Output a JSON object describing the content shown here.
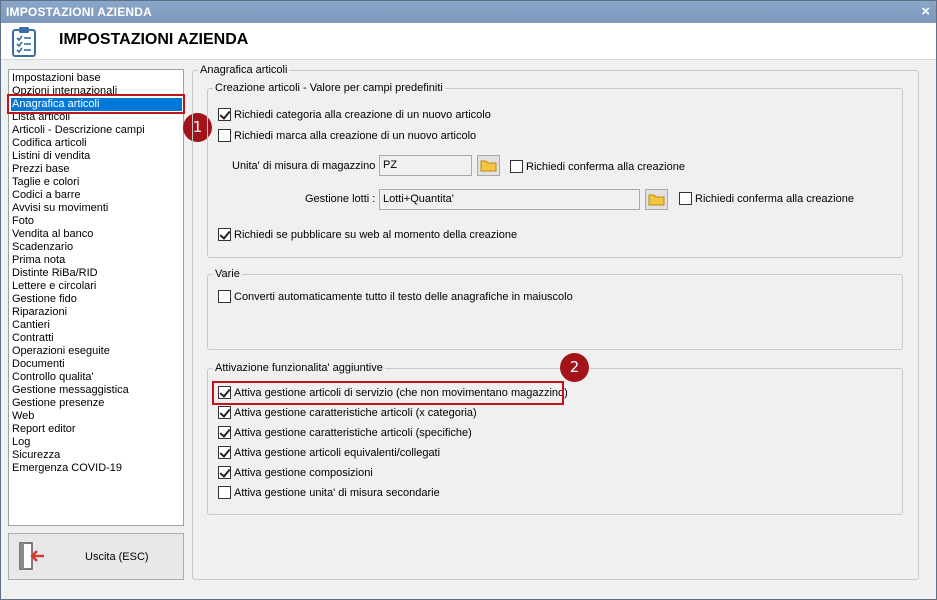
{
  "window": {
    "title": "IMPOSTAZIONI AZIENDA",
    "close_glyph": "×"
  },
  "header": {
    "title": "IMPOSTAZIONI AZIENDA",
    "icon": "clipboard-checklist-icon"
  },
  "sidebar": {
    "items": [
      {
        "label": "Impostazioni base"
      },
      {
        "label": "Opzioni internazionali"
      },
      {
        "label": "Anagrafica articoli"
      },
      {
        "label": "Lista articoli"
      },
      {
        "label": "Articoli - Descrizione campi"
      },
      {
        "label": "Codifica articoli"
      },
      {
        "label": "Listini di vendita"
      },
      {
        "label": "Prezzi base"
      },
      {
        "label": "Taglie e colori"
      },
      {
        "label": "Codici a barre"
      },
      {
        "label": "Avvisi su movimenti"
      },
      {
        "label": "Foto"
      },
      {
        "label": "Vendita al banco"
      },
      {
        "label": "Scadenzario"
      },
      {
        "label": "Prima nota"
      },
      {
        "label": "Distinte RiBa/RID"
      },
      {
        "label": "Lettere e circolari"
      },
      {
        "label": "Gestione fido"
      },
      {
        "label": "Riparazioni"
      },
      {
        "label": "Cantieri"
      },
      {
        "label": "Contratti"
      },
      {
        "label": "Operazioni eseguite"
      },
      {
        "label": "Documenti"
      },
      {
        "label": "Controllo qualita'"
      },
      {
        "label": "Gestione messaggistica"
      },
      {
        "label": "Gestione presenze"
      },
      {
        "label": "Web"
      },
      {
        "label": "Report editor"
      },
      {
        "label": "Log"
      },
      {
        "label": "Sicurezza"
      },
      {
        "label": "Emergenza COVID-19"
      }
    ],
    "selected_index": 2
  },
  "callouts": {
    "one": "1",
    "two": "2"
  },
  "exit_button": {
    "label": "Uscita (ESC)",
    "icon": "exit-door-icon"
  },
  "main": {
    "panel_title": "Anagrafica articoli",
    "creation_group": {
      "legend": "Creazione articoli - Valore per campi predefiniti",
      "cb_category": {
        "label": "Richiedi categoria alla creazione di un nuovo articolo",
        "checked": true
      },
      "cb_brand": {
        "label": "Richiedi marca alla creazione di un nuovo articolo",
        "checked": false
      },
      "unit_label": "Unita' di misura di magazzino :",
      "unit_value": "PZ",
      "unit_confirm": {
        "label": "Richiedi conferma alla creazione",
        "checked": false
      },
      "lots_label": "Gestione lotti :",
      "lots_value": "Lotti+Quantita'",
      "lots_confirm": {
        "label": "Richiedi conferma alla creazione",
        "checked": false
      },
      "cb_web": {
        "label": "Richiedi se pubblicare su web al momento della creazione",
        "checked": true
      }
    },
    "varie_group": {
      "legend": "Varie",
      "cb_uppercase": {
        "label": "Converti automaticamente tutto il testo delle anagrafiche in maiuscolo",
        "checked": false
      }
    },
    "features_group": {
      "legend": "Attivazione funzionalita' aggiuntive",
      "items": [
        {
          "label": "Attiva gestione articoli di servizio (che non movimentano magazzino)",
          "checked": true
        },
        {
          "label": "Attiva gestione caratteristiche articoli (x categoria)",
          "checked": true
        },
        {
          "label": "Attiva gestione caratteristiche articoli (specifiche)",
          "checked": true
        },
        {
          "label": "Attiva gestione articoli equivalenti/collegati",
          "checked": true
        },
        {
          "label": "Attiva gestione composizioni",
          "checked": true
        },
        {
          "label": "Attiva gestione unita' di misura secondarie",
          "checked": false
        }
      ]
    }
  }
}
